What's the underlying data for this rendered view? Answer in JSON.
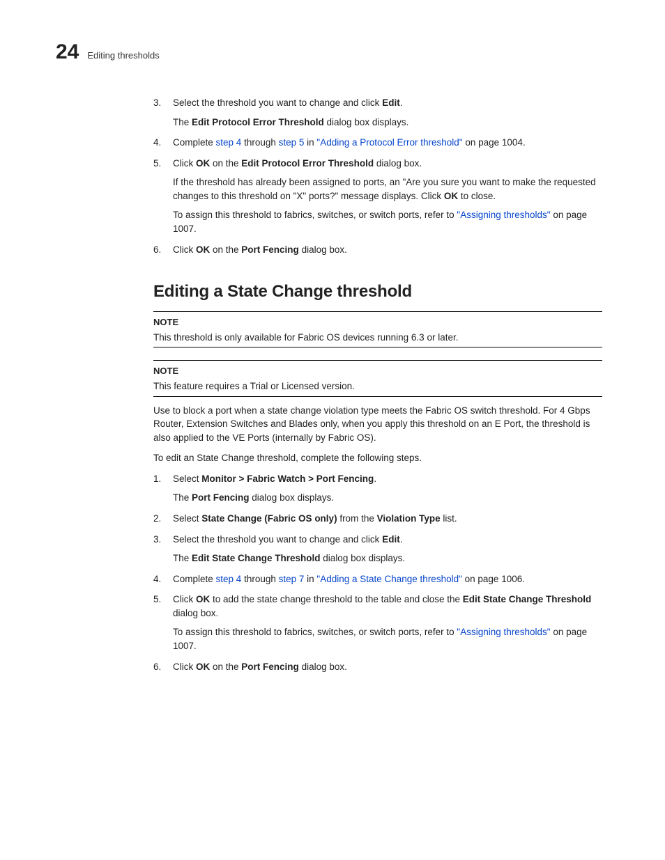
{
  "header": {
    "chapter_number": "24",
    "running_title": "Editing thresholds"
  },
  "stepsA": {
    "s3": {
      "text_a": "Select the threshold you want to change and click ",
      "edit": "Edit",
      "period": ".",
      "sub_a": "The ",
      "sub_b": "Edit Protocol Error Threshold",
      "sub_c": " dialog box displays."
    },
    "s4": {
      "a": "Complete ",
      "link1": "step 4",
      "b": " through ",
      "link2": "step 5",
      "c": " in ",
      "link3": "\"Adding a Protocol Error threshold\"",
      "d": " on page 1004."
    },
    "s5": {
      "a": "Click ",
      "ok": "OK",
      "b": " on the ",
      "dlg": "Edit Protocol Error Threshold",
      "c": " dialog box.",
      "p1a": "If the threshold has already been assigned to ports, an \"Are you sure you want to make the requested changes to this threshold on \"X\" ports?\" message displays. Click ",
      "p1ok": "OK",
      "p1b": " to close.",
      "p2a": "To assign this threshold to fabrics, switches, or switch ports, refer to ",
      "p2link": "\"Assigning thresholds\"",
      "p2b": " on page 1007."
    },
    "s6": {
      "a": "Click ",
      "ok": "OK",
      "b": " on the ",
      "dlg": "Port Fencing",
      "c": " dialog box."
    }
  },
  "section": {
    "title": "Editing a State Change threshold",
    "note1": {
      "label": "NOTE",
      "body": "This threshold is only available for Fabric OS devices running 6.3 or later."
    },
    "note2": {
      "label": "NOTE",
      "body": "This feature requires a Trial or Licensed version."
    },
    "intro1": "Use to block a port when a state change violation type meets the Fabric OS switch threshold. For 4 Gbps Router, Extension Switches and Blades only, when you apply this threshold on an E Port, the threshold is also applied to the VE Ports (internally by Fabric OS).",
    "intro2": "To edit an State Change threshold, complete the following steps."
  },
  "stepsB": {
    "s1": {
      "a": "Select ",
      "path": "Monitor > Fabric Watch > Port Fencing",
      "b": ".",
      "sub_a": "The ",
      "sub_b": "Port Fencing",
      "sub_c": " dialog box displays."
    },
    "s2": {
      "a": "Select ",
      "opt": "State Change (Fabric OS only)",
      "b": " from the ",
      "list": "Violation Type",
      "c": " list."
    },
    "s3": {
      "a": "Select the threshold you want to change and click ",
      "edit": "Edit",
      "b": ".",
      "sub_a": "The ",
      "sub_b": "Edit State Change Threshold",
      "sub_c": " dialog box displays."
    },
    "s4": {
      "a": "Complete ",
      "link1": "step 4",
      "b": " through ",
      "link2": "step 7",
      "c": " in ",
      "link3": "\"Adding a State Change threshold\"",
      "d": " on page 1006."
    },
    "s5": {
      "a": "Click ",
      "ok": "OK",
      "b": " to add the state change threshold to the table and close the ",
      "dlg": "Edit State Change Threshold",
      "c": " dialog box.",
      "p2a": "To assign this threshold to fabrics, switches, or switch ports, refer to ",
      "p2link": "\"Assigning thresholds\"",
      "p2b": " on page 1007."
    },
    "s6": {
      "a": "Click ",
      "ok": "OK",
      "b": " on the ",
      "dlg": "Port Fencing",
      "c": " dialog box."
    }
  }
}
